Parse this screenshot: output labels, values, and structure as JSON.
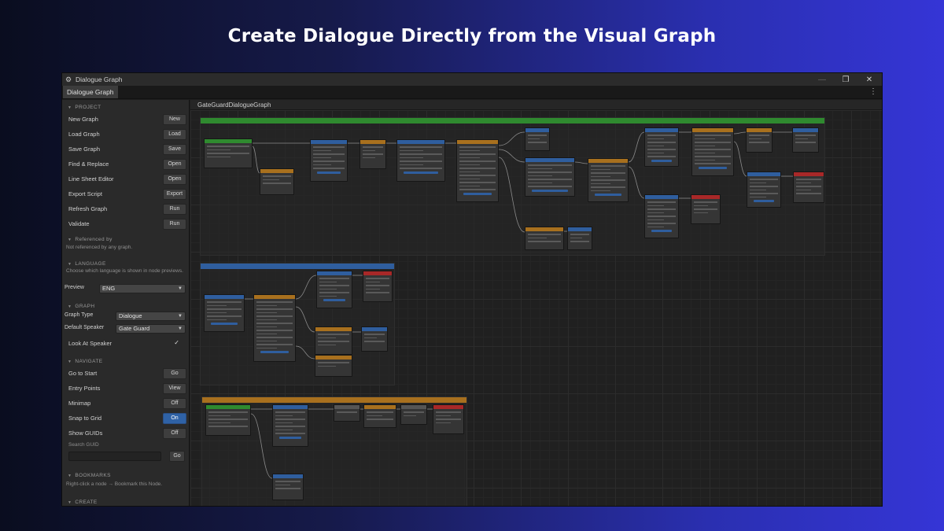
{
  "headline": "Create Dialogue Directly from the Visual Graph",
  "window": {
    "title": "Dialogue Graph",
    "tab": "Dialogue Graph",
    "canvas_title": "GateGuardDialogueGraph"
  },
  "sidebar": {
    "project": {
      "header": "PROJECT",
      "items": [
        {
          "label": "New Graph",
          "button": "New"
        },
        {
          "label": "Load Graph",
          "button": "Load"
        },
        {
          "label": "Save Graph",
          "button": "Save"
        },
        {
          "label": "Find & Replace",
          "button": "Open"
        },
        {
          "label": "Line Sheet Editor",
          "button": "Open"
        },
        {
          "label": "Export Script",
          "button": "Export"
        },
        {
          "label": "Refresh Graph",
          "button": "Run"
        },
        {
          "label": "Validate",
          "button": "Run"
        }
      ],
      "referenced_header": "Referenced by",
      "referenced_note": "Not referenced by any graph."
    },
    "language": {
      "header": "LANGUAGE",
      "note": "Choose which language is shown in node previews.",
      "preview_label": "Preview",
      "preview_value": "ENG"
    },
    "graph": {
      "header": "GRAPH",
      "type_label": "Graph Type",
      "type_value": "Dialogue",
      "speaker_label": "Default Speaker",
      "speaker_value": "Gate Guard",
      "look_label": "Look At Speaker",
      "look_checked": "✓"
    },
    "navigate": {
      "header": "NAVIGATE",
      "items": [
        {
          "label": "Go to Start",
          "button": "Go",
          "active": false
        },
        {
          "label": "Entry Points",
          "button": "View",
          "active": false
        },
        {
          "label": "Minimap",
          "button": "Off",
          "active": false
        },
        {
          "label": "Snap to Grid",
          "button": "On",
          "active": true
        },
        {
          "label": "Show GUIDs",
          "button": "Off",
          "active": false
        }
      ],
      "search_label": "Search GUID",
      "search_button": "Go"
    },
    "bookmarks": {
      "header": "BOOKMARKS",
      "note": "Right-click a node → Bookmark this Node."
    },
    "create": {
      "header": "CREATE"
    }
  },
  "colors": {
    "green": "#2f8a2f",
    "blue": "#2f5e9e",
    "orange": "#a8701e",
    "red": "#a82828",
    "gray": "#555555"
  }
}
